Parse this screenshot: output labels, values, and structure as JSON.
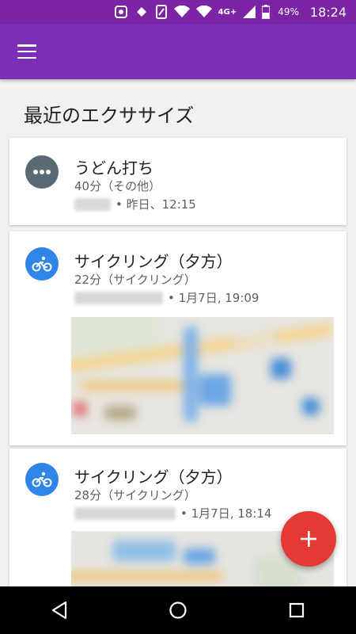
{
  "status_bar": {
    "network": "4G+",
    "battery": "49%",
    "time": "18:24"
  },
  "app_bar": {
    "menu_icon": "hamburger-menu-icon"
  },
  "section_title": "最近のエクササイズ",
  "activities": [
    {
      "icon": "more-horiz-icon",
      "title": "うどん打ち",
      "subtitle": "40分（その他）",
      "meta": "• 昨日、12:15"
    },
    {
      "icon": "bicycle-icon",
      "title": "サイクリング（夕方）",
      "subtitle": "22分（サイクリング）",
      "meta": "• 1月7日, 19:09"
    },
    {
      "icon": "bicycle-icon",
      "title": "サイクリング（夕方）",
      "subtitle": "28分（サイクリング）",
      "meta": "• 1月7日, 18:14"
    }
  ],
  "fab": {
    "label": "+",
    "icon": "add-icon",
    "color": "#e53935"
  },
  "colors": {
    "app_bar": "#7b2fb4",
    "status_bar": "#7b24a6",
    "bike_icon_bg": "#2f86e8",
    "other_icon_bg": "#5a6a74"
  },
  "nav": {
    "back_icon": "back-triangle-icon",
    "home_icon": "home-circle-icon",
    "recents_icon": "recents-square-icon"
  }
}
